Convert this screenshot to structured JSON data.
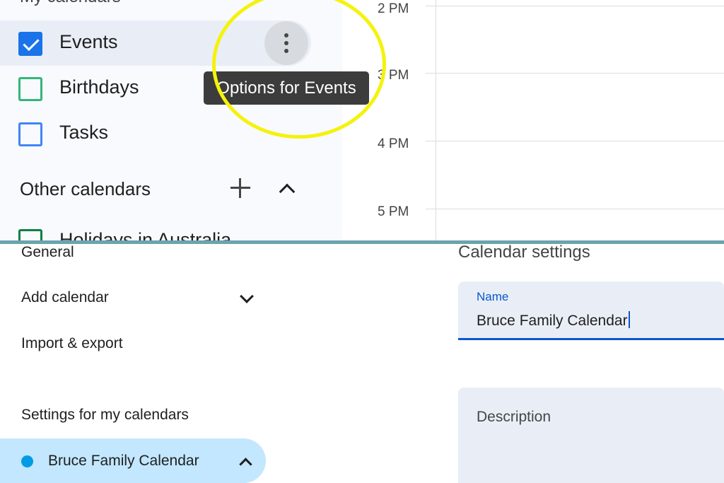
{
  "top": {
    "sidebar": {
      "my_calendars_heading": "My calendars",
      "calendars": [
        {
          "label": "Events",
          "checked": true,
          "color": "#1a73e8"
        },
        {
          "label": "Birthdays",
          "checked": false,
          "color": "#33b679"
        },
        {
          "label": "Tasks",
          "checked": false,
          "color": "#4285f4"
        }
      ],
      "options_tooltip": "Options for Events",
      "other_calendars_heading": "Other calendars",
      "other_calendars": [
        {
          "label": "Holidays in Australia",
          "checked": false,
          "color": "#0b8043"
        }
      ],
      "icons": [
        "more-vert-icon",
        "plus-icon",
        "chevron-up-icon"
      ]
    },
    "time_grid": {
      "times": [
        "2 PM",
        "3 PM",
        "4 PM",
        "5 PM"
      ]
    },
    "annotation_color": "#f5f20c"
  },
  "bottom": {
    "nav": {
      "general": "General",
      "add_calendar": "Add calendar",
      "import_export": "Import & export",
      "settings_for_my_calendars": "Settings for my calendars",
      "selected_calendar": "Bruce Family Calendar",
      "selected_calendar_color": "#039be5"
    },
    "calendar_settings": {
      "title": "Calendar settings",
      "name_label": "Name",
      "name_value": "Bruce Family Calendar",
      "description_placeholder": "Description"
    }
  }
}
